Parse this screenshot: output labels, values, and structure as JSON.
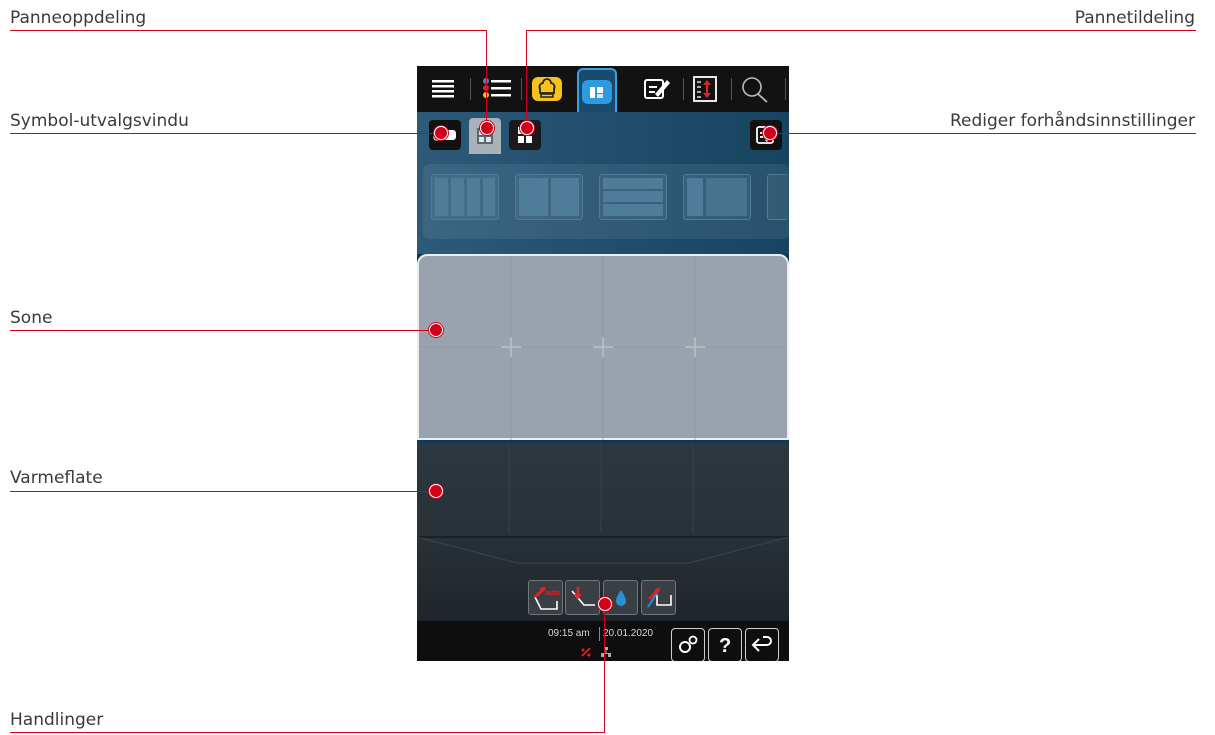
{
  "callouts": {
    "panneoppdeling": "Panneoppdeling",
    "pannetildeling": "Pannetildeling",
    "symbol_utvalgsvindu": "Symbol-utvalgsvindu",
    "rediger": "Rediger forhåndsinnstillinger",
    "sone": "Sone",
    "varmeflate": "Varmeflate",
    "handlinger": "Handlinger"
  },
  "topbar_icons": [
    "menu-lines-icon",
    "settings-sliders-icon",
    "chef-hat-icon",
    "pan-layout-icon",
    "edit-icon",
    "height-adjust-icon",
    "search-icon"
  ],
  "actions": [
    "auto-tilt-icon",
    "lower-icon",
    "water-icon",
    "fill-icon"
  ],
  "status": {
    "time": "09:15 am",
    "date": "20.01.2020"
  },
  "bottom_buttons": [
    "settings-gear-icon",
    "help-icon",
    "back-arrow-icon"
  ],
  "colors": {
    "callout_red": "#d0021b",
    "active_blue": "#3aa0e0",
    "chef_yellow": "#f7c21c"
  }
}
